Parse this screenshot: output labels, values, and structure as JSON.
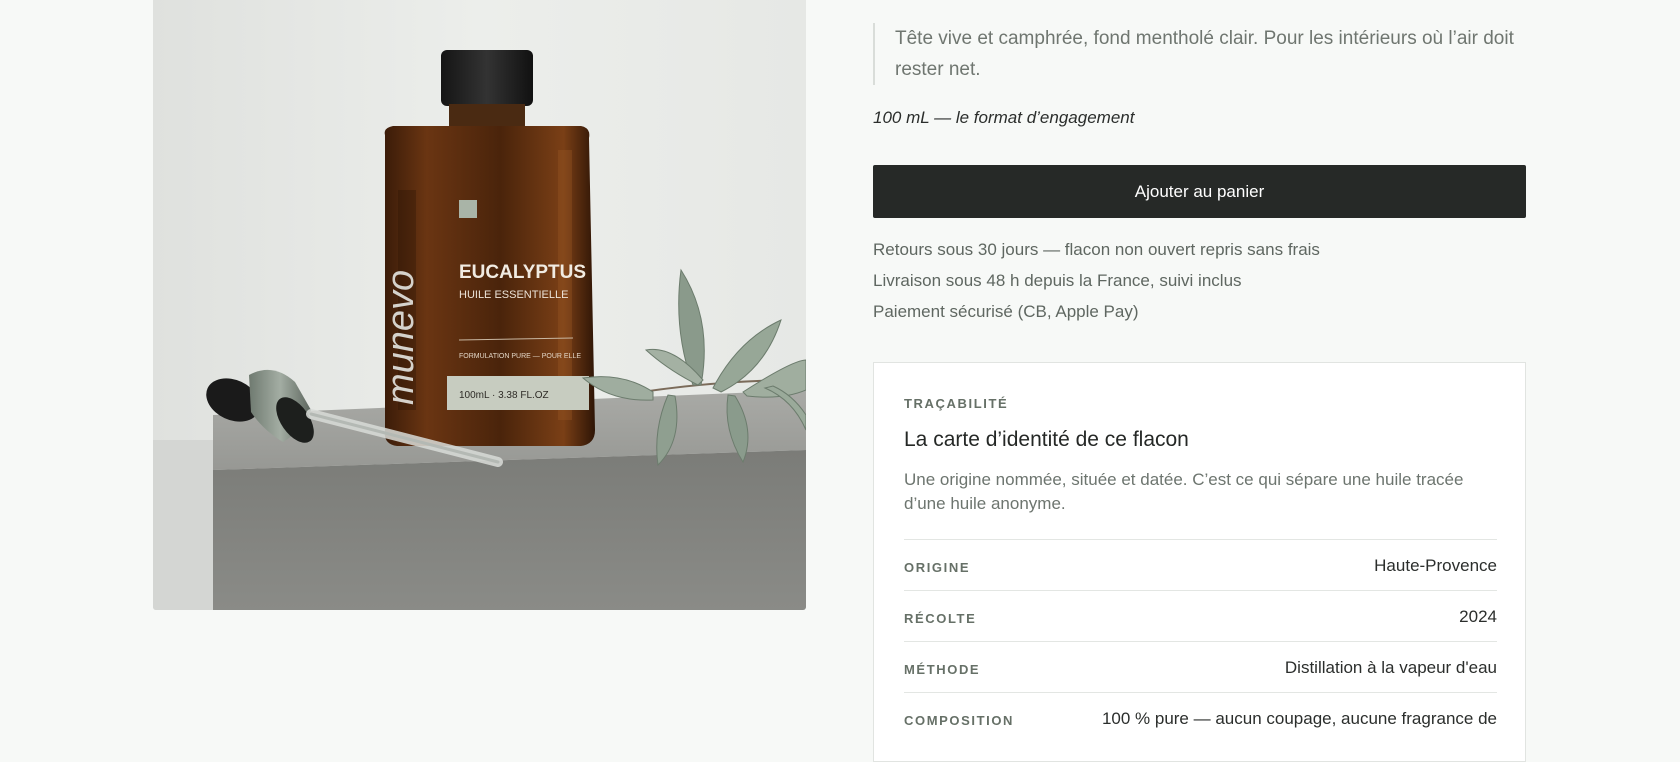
{
  "product": {
    "image_alt": "Flacon d'huile essentielle Eucalyptus munevo",
    "bottle": {
      "brand": "munevo",
      "name": "EUCALYPTUS",
      "subtitle": "HUILE ESSENTIELLE",
      "formula": "FORMULATION PURE — POUR ELLE",
      "volume": "100mL · 3.38 FL.OZ"
    },
    "description": "Tête vive et camphrée, fond mentholé clair. Pour les intérieurs où l’air doit rester net.",
    "format": "100 mL — le format d’engagement",
    "cart_button": "Ajouter au panier",
    "reassurance": [
      "Retours sous 30 jours — flacon non ouvert repris sans frais",
      "Livraison sous 48 h depuis la France, suivi inclus",
      "Paiement sécurisé (CB, Apple Pay)"
    ]
  },
  "traceability": {
    "eyebrow": "TRAÇABILITÉ",
    "title": "La carte d’identité de ce flacon",
    "description": "Une origine nommée, située et datée. C’est ce qui sépare une huile tracée d’une huile anonyme.",
    "rows": [
      {
        "label": "ORIGINE",
        "value": "Haute-Provence"
      },
      {
        "label": "RÉCOLTE",
        "value": "2024"
      },
      {
        "label": "MÉTHODE",
        "value": "Distillation à la vapeur d'eau"
      },
      {
        "label": "COMPOSITION",
        "value": "100 % pure — aucun coupage, aucune fragrance de"
      }
    ]
  },
  "colors": {
    "background": "#f7f9f7",
    "button": "#262927",
    "muted_text": "#6f7670",
    "label": "#667067"
  }
}
